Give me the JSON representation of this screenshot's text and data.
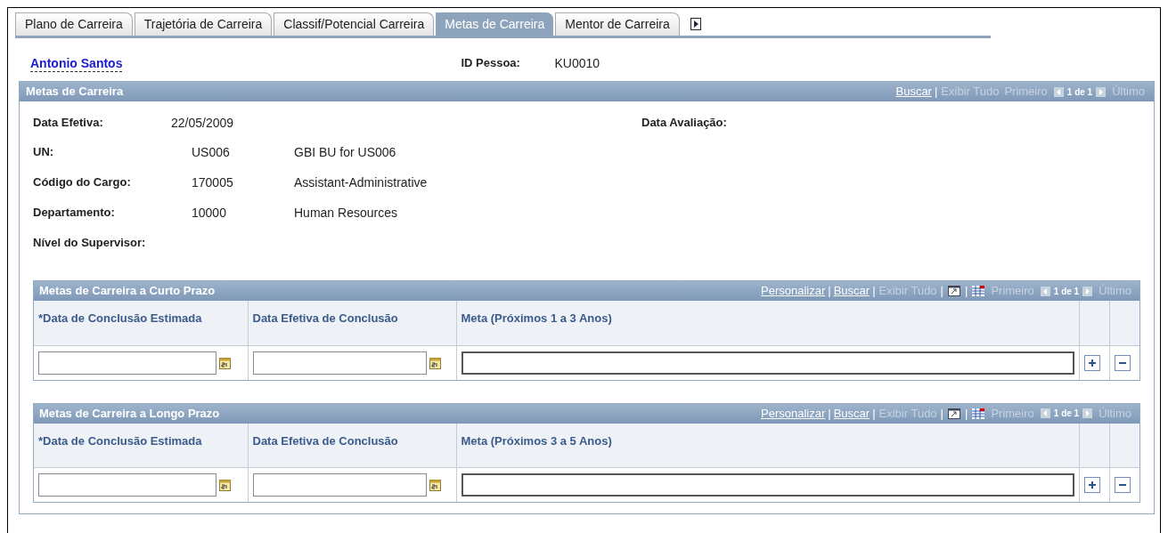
{
  "tabs": [
    {
      "label": "Plano de Carreira",
      "selected": false
    },
    {
      "label": "Trajetória de Carreira",
      "selected": false
    },
    {
      "label": "Classif/Potencial Carreira",
      "selected": false
    },
    {
      "label": "Metas de Carreira",
      "selected": true
    },
    {
      "label": "Mentor de Carreira",
      "selected": false
    }
  ],
  "person": {
    "name": "Antonio Santos",
    "id_label": "ID Pessoa:",
    "id_value": "KU0010"
  },
  "panel": {
    "title": "Metas de Carreira",
    "nav": [
      {
        "kind": "link",
        "text": "Buscar"
      },
      {
        "kind": "sep",
        "text": "|"
      },
      {
        "kind": "disabled",
        "text": "Exibir Tudo"
      },
      {
        "kind": "disabled",
        "text": "Primeiro"
      },
      {
        "kind": "prev"
      },
      {
        "kind": "count",
        "text": "1 de 1"
      },
      {
        "kind": "next"
      },
      {
        "kind": "disabled",
        "text": "Último"
      }
    ],
    "effective_label": "Data Efetiva:",
    "effective_value": "22/05/2009",
    "review_label": "Data Avaliação:",
    "fields": [
      {
        "label": "UN:",
        "code": "US006",
        "description": "GBI BU for US006"
      },
      {
        "label": "Código do Cargo:",
        "code": "170005",
        "description": "Assistant-Administrative"
      },
      {
        "label": "Departamento:",
        "code": "10000",
        "description": "Human Resources"
      },
      {
        "label": "Nível do Supervisor:"
      }
    ]
  },
  "grids": [
    {
      "title": "Metas de Carreira a Curto Prazo",
      "nav": [
        {
          "kind": "link",
          "text": "Personalizar"
        },
        {
          "kind": "sep",
          "text": "|"
        },
        {
          "kind": "link",
          "text": "Buscar"
        },
        {
          "kind": "sep",
          "text": "|"
        },
        {
          "kind": "disabled",
          "text": "Exibir Tudo"
        },
        {
          "kind": "sep",
          "text": "|"
        },
        {
          "kind": "zoom"
        },
        {
          "kind": "sep",
          "text": "|"
        },
        {
          "kind": "grid"
        },
        {
          "kind": "disabled",
          "text": "Primeiro"
        },
        {
          "kind": "prev"
        },
        {
          "kind": "count",
          "text": "1 de 1"
        },
        {
          "kind": "next"
        },
        {
          "kind": "disabled",
          "text": "Último"
        }
      ],
      "columns": [
        "*Data de Conclusão Estimada",
        "Data Efetiva de Conclusão",
        "Meta (Próximos 1 a 3 Anos)"
      ]
    },
    {
      "title": "Metas de Carreira a Longo Prazo",
      "nav": [
        {
          "kind": "link",
          "text": "Personalizar"
        },
        {
          "kind": "sep",
          "text": "|"
        },
        {
          "kind": "link",
          "text": "Buscar"
        },
        {
          "kind": "sep",
          "text": "|"
        },
        {
          "kind": "disabled",
          "text": "Exibir Tudo"
        },
        {
          "kind": "sep",
          "text": "|"
        },
        {
          "kind": "zoom"
        },
        {
          "kind": "sep",
          "text": "|"
        },
        {
          "kind": "grid"
        },
        {
          "kind": "disabled",
          "text": "Primeiro"
        },
        {
          "kind": "prev"
        },
        {
          "kind": "count",
          "text": "1 de 1"
        },
        {
          "kind": "next"
        },
        {
          "kind": "disabled",
          "text": "Último"
        }
      ],
      "columns": [
        "*Data de Conclusão Estimada",
        "Data Efetiva de Conclusão",
        "Meta (Próximos 3 a 5 Anos)"
      ]
    }
  ]
}
